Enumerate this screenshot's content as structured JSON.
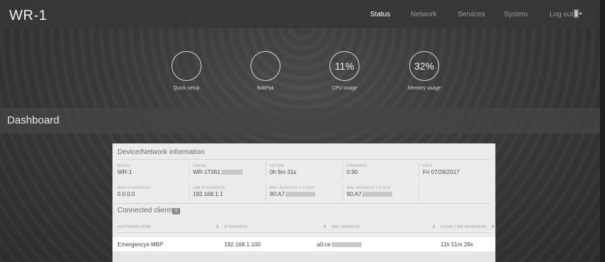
{
  "header": {
    "brand": "WR-1",
    "nav": [
      "Status",
      "Network",
      "Services",
      "System",
      "Log out"
    ]
  },
  "hero": [
    {
      "value": "",
      "label": "Quick setup"
    },
    {
      "value": "",
      "label": "BakPak"
    },
    {
      "value": "11%",
      "label": "CPU usage"
    },
    {
      "value": "32%",
      "label": "Memory usage"
    }
  ],
  "dashboard": {
    "title": "Dashboard"
  },
  "device": {
    "title": "Device/Network information",
    "fields": [
      {
        "label": "MODEL",
        "value": "WR-1"
      },
      {
        "label": "SERIAL",
        "value": "WR-1T061"
      },
      {
        "label": "UPTIME",
        "value": "0h 9m 31s"
      },
      {
        "label": "FIRMWARE",
        "value": "0.90"
      },
      {
        "label": "DATE",
        "value": "Fri 07/28/2017"
      },
      {
        "label": "WAN IP ADDRESS",
        "value": "0.0.0.0"
      },
      {
        "label": "LAN IP ADDRESS",
        "value": "192.168.1.1"
      },
      {
        "label": "MAC ADDRESS 2.4 GHZ",
        "value": "90:A7"
      },
      {
        "label": "MAC ADDRESS 5.0 GHZ",
        "value": "90:A7"
      }
    ]
  },
  "clients": {
    "title": "Connected clients",
    "count": "1",
    "columns": [
      "HOSTNAME/ZONE",
      "IP ADDRESS",
      "MAC ADDRESS",
      "LEASE TIME REMAINING"
    ],
    "rows": [
      {
        "hostname": "Emergencys-MBP",
        "ip": "192.168.1.100",
        "mac": "a0:ce",
        "lease": "11h 51m 26s"
      }
    ]
  },
  "colors": {
    "background": "#3a3a3a",
    "card": "#ececec",
    "text_light": "#e6e6e6",
    "text_dark": "#4a4a4a"
  }
}
